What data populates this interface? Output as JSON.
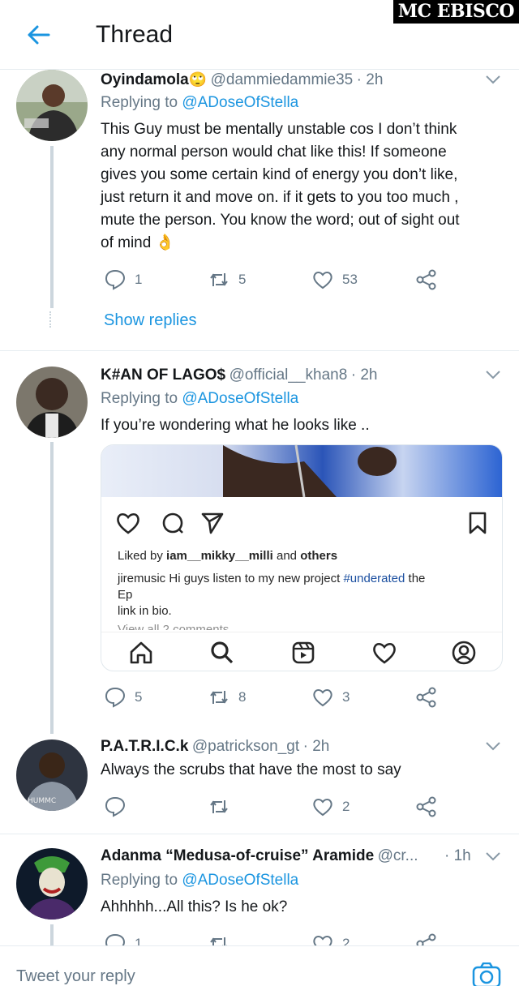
{
  "header": {
    "title": "Thread",
    "watermark": "MC EBISCO"
  },
  "tweets": [
    {
      "name": "Oyindamola",
      "emoji": "🙄",
      "handle": "@dammiedammie35",
      "time": "· 2h",
      "replying_label": "Replying to",
      "replying_to": "@ADoseOfStella",
      "lines": [
        "This Guy must be mentally unstable cos I don’t think",
        "any normal person would chat like this! If someone",
        "gives you some certain kind of energy you don’t like,",
        "just return it and move on. if it gets to you too much ,",
        "mute the person. You know the word; out of sight out",
        "of mind 👌"
      ],
      "replies": "1",
      "retweets": "5",
      "likes": "53",
      "show_replies": "Show replies"
    },
    {
      "name": "K#AN OF LAGO$",
      "handle": "@official__khan8",
      "time": "· 2h",
      "replying_label": "Replying to",
      "replying_to": "@ADoseOfStella",
      "lines": [
        "If you’re wondering what he looks like .."
      ],
      "media": {
        "liked_by_prefix": "Liked by",
        "liked_by_user": "iam__mikky__milli",
        "liked_by_suffix": "and",
        "liked_by_others": "others",
        "caption_user": "jiremusic",
        "caption_text": "Hi guys listen to my new project",
        "caption_tag": "#underated",
        "caption_end": "the",
        "caption_line2": "Ep",
        "caption_line3": "link in bio.",
        "comments_peek": "View all 2 comments"
      },
      "replies": "5",
      "retweets": "8",
      "likes": "3"
    },
    {
      "name": "P.A.T.R.I.C.k",
      "handle": "@patrickson_gt",
      "time": "· 2h",
      "lines": [
        "Always the scrubs that have the most to say"
      ],
      "replies": "",
      "retweets": "",
      "likes": "2"
    },
    {
      "name": "Adanma “Medusa-of-cruise” Aramide",
      "handle": "@cr...",
      "time": "· 1h",
      "replying_label": "Replying to",
      "replying_to": "@ADoseOfStella",
      "lines": [
        "Ahhhhh...All this? Is he ok?"
      ],
      "replies": "1",
      "retweets": "",
      "likes": "2"
    }
  ],
  "compose": {
    "placeholder": "Tweet your reply"
  },
  "colors": {
    "accent": "#1b95e0",
    "text": "#14171a",
    "muted": "#657786",
    "line": "#ccd6dd"
  }
}
